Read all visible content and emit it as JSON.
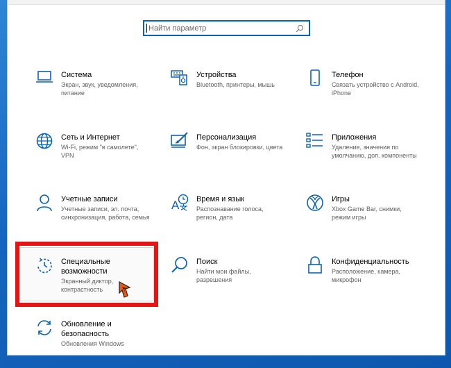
{
  "search": {
    "placeholder": "Найти параметр"
  },
  "colors": {
    "accent": "#0a64b4",
    "highlight": "#e31515"
  },
  "tiles": [
    {
      "key": "system",
      "icon": "laptop-icon",
      "title": "Система",
      "desc": "Экран, звук, уведомления,\nпитание"
    },
    {
      "key": "devices",
      "icon": "keyboard-speaker-icon",
      "title": "Устройства",
      "desc": "Bluetooth, принтеры, мышь"
    },
    {
      "key": "phone",
      "icon": "phone-icon",
      "title": "Телефон",
      "desc": "Связать устройство с Android,\niPhone"
    },
    {
      "key": "network",
      "icon": "globe-icon",
      "title": "Сеть и Интернет",
      "desc": "Wi-Fi, режим \"в самолете\",\nVPN"
    },
    {
      "key": "personalization",
      "icon": "paintbrush-monitor-icon",
      "title": "Персонализация",
      "desc": "Фон, экран блокировки, цвета"
    },
    {
      "key": "apps",
      "icon": "apps-list-icon",
      "title": "Приложения",
      "desc": "Удаление, значения по\nумолчанию, доп. компоненты"
    },
    {
      "key": "accounts",
      "icon": "person-icon",
      "title": "Учетные записи",
      "desc": "Учетные записи, эл. почта,\nсинхронизация, работа, семья"
    },
    {
      "key": "time",
      "icon": "time-language-icon",
      "title": "Время и язык",
      "desc": "Распознавание голоса,\nрегион, дата"
    },
    {
      "key": "gaming",
      "icon": "xbox-icon",
      "title": "Игры",
      "desc": "Xbox Game Bar, снимки,\nрежим игры"
    },
    {
      "key": "ease",
      "icon": "ease-of-access-icon",
      "title": "Специальные\nвозможности",
      "desc": "Экранный диктор,\nконтрастность"
    },
    {
      "key": "search",
      "icon": "search-magnifier-icon",
      "title": "Поиск",
      "desc": "Найти мои файлы,\nразрешения"
    },
    {
      "key": "privacy",
      "icon": "lock-icon",
      "title": "Конфиденциальность",
      "desc": "Расположение, камера,\nмикрофон"
    },
    {
      "key": "update",
      "icon": "sync-arrows-icon",
      "title": "Обновление и\nбезопасность",
      "desc": "Обновления Windows"
    }
  ]
}
